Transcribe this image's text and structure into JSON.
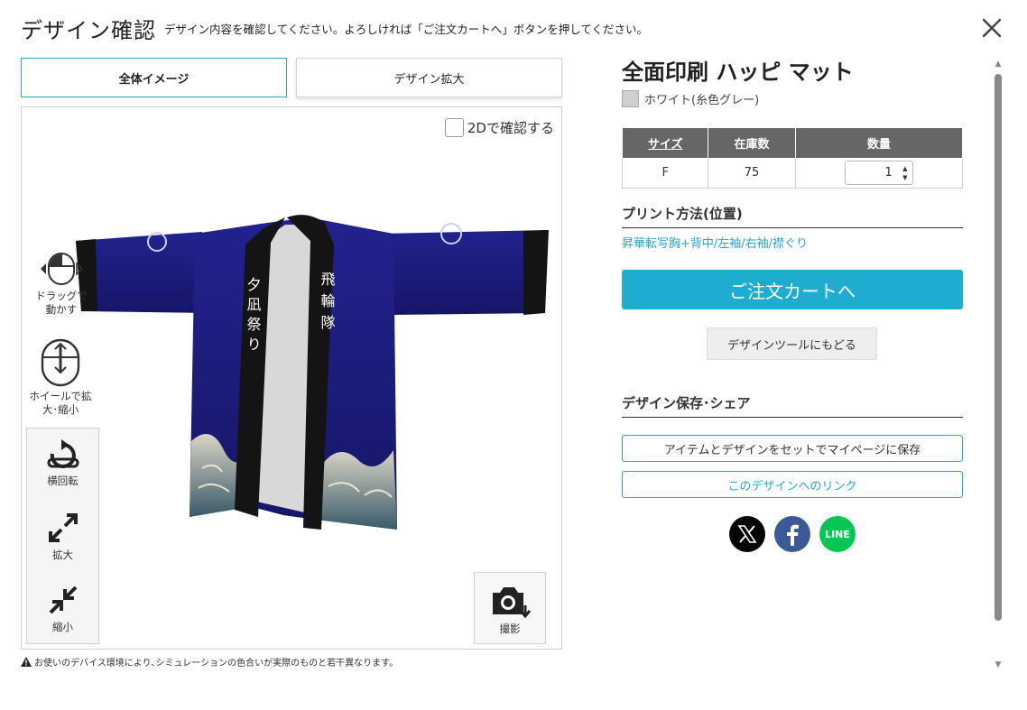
{
  "header": {
    "title": "デザイン確認",
    "subtitle": "デザイン内容を確認してください。よろしければ「ご注文カートへ」ボタンを押してください。"
  },
  "view_tabs": [
    "全体イメージ",
    "デザイン拡大"
  ],
  "viewer": {
    "check_2d_label": "2Dで確認する",
    "drag_hint": "ドラッグで動かす",
    "wheel_hint": "ホイールで拡大･縮小",
    "tools": {
      "rotate": "横回転",
      "zoom_in": "拡大",
      "zoom_out": "縮小"
    },
    "camera_label": "撮影",
    "garment_text_right": "飛輪隊",
    "garment_text_left": "夕凪祭り"
  },
  "disclaimer": "お使いのデバイス環境により､シミュレーションの色合いが実際のものと若干異なります。",
  "product": {
    "title": "全面印刷 ハッピ マット",
    "color_name": "ホワイト(糸色グレー)",
    "table": {
      "headers": [
        "サイズ",
        "在庫数",
        "数量"
      ],
      "rows": [
        {
          "size": "F",
          "stock": "75",
          "quantity": "1"
        }
      ]
    },
    "print_heading": "プリント方法(位置)",
    "print_method": "昇華転写胸+背中/左袖/右袖/襟ぐり"
  },
  "buttons": {
    "cart": "ご注文カートへ",
    "back_to_tool": "デザインツールにもどる",
    "save_mypage": "アイテムとデザインをセットでマイページに保存",
    "design_link": "このデザインへのリンク"
  },
  "share": {
    "heading": "デザイン保存･シェア",
    "line_label": "LINE"
  },
  "colors": {
    "accent": "#1eadd0",
    "garment_body": "#1e1e8c",
    "collar": "#141414",
    "facebook": "#3b5998",
    "line": "#06c755",
    "x": "#000000"
  }
}
